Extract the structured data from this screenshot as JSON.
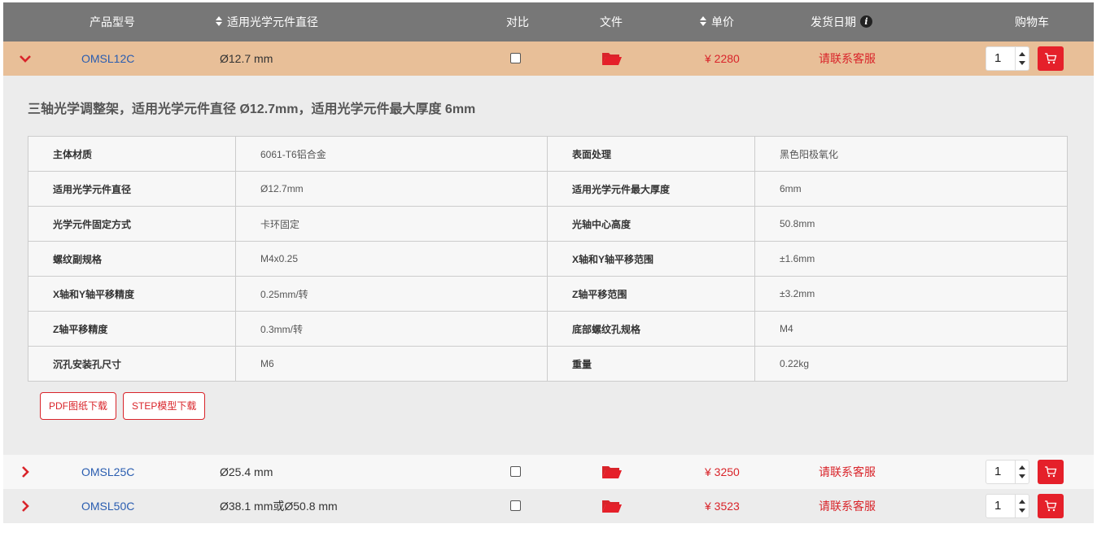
{
  "header": {
    "model": "产品型号",
    "diameter": "适用光学元件直径",
    "compare": "对比",
    "file": "文件",
    "price": "单价",
    "ship": "发货日期",
    "cart": "购物车"
  },
  "colors": {
    "header_bg": "#777777",
    "active_row": "#e8bf98",
    "accent_red": "#d9242a",
    "link_blue": "#2a5db0"
  },
  "rows": [
    {
      "model": "OMSL12C",
      "diameter": "Ø12.7 mm",
      "price": "¥ 2280",
      "ship": "请联系客服",
      "qty": "1",
      "expanded": true
    },
    {
      "model": "OMSL25C",
      "diameter": "Ø25.4 mm",
      "price": "¥ 3250",
      "ship": "请联系客服",
      "qty": "1",
      "expanded": false
    },
    {
      "model": "OMSL50C",
      "diameter": "Ø38.1 mm或Ø50.8 mm",
      "price": "¥ 3523",
      "ship": "请联系客服",
      "qty": "1",
      "expanded": false
    }
  ],
  "detail": {
    "title": "三轴光学调整架，适用光学元件直径 Ø12.7mm，适用光学元件最大厚度 6mm",
    "specs": [
      [
        "主体材质",
        "6061-T6铝合金",
        "表面处理",
        "黑色阳极氧化"
      ],
      [
        "适用光学元件直径",
        "Ø12.7mm",
        "适用光学元件最大厚度",
        "6mm"
      ],
      [
        "光学元件固定方式",
        "卡环固定",
        "光轴中心高度",
        "50.8mm"
      ],
      [
        "螺纹副规格",
        "M4x0.25",
        "X轴和Y轴平移范围",
        "±1.6mm"
      ],
      [
        "X轴和Y轴平移精度",
        "0.25mm/转",
        "Z轴平移范围",
        "±3.2mm"
      ],
      [
        "Z轴平移精度",
        "0.3mm/转",
        "底部螺纹孔规格",
        "M4"
      ],
      [
        "沉孔安装孔尺寸",
        "M6",
        "重量",
        "0.22kg"
      ]
    ],
    "pdf_button": "PDF图纸下载",
    "step_button": "STEP模型下载"
  }
}
